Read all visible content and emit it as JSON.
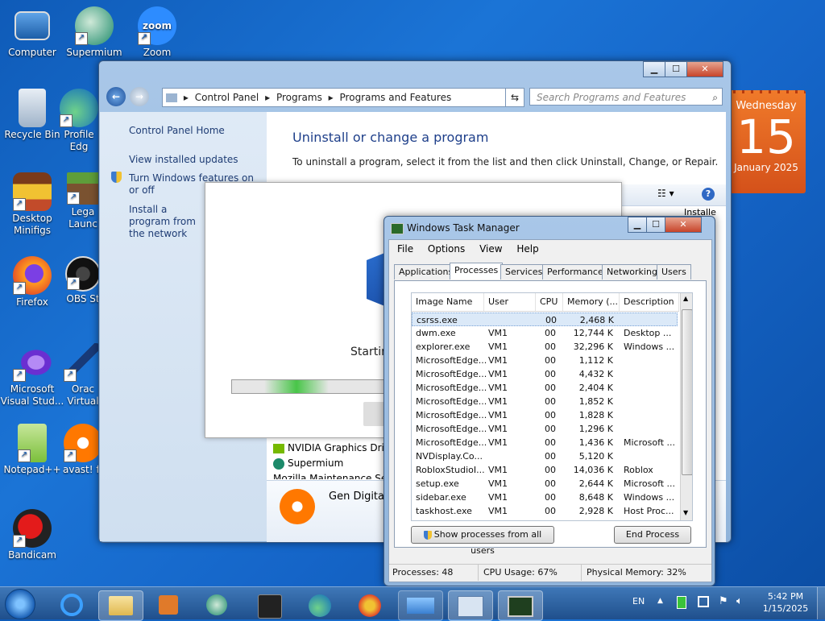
{
  "desktop": {
    "icons": [
      {
        "label": "Computer"
      },
      {
        "label": "Supermium"
      },
      {
        "label": "Zoom"
      },
      {
        "label": "Recycle Bin"
      },
      {
        "label": "Profile\nEdg"
      },
      {
        "label": "Desktop\nMinifigs"
      },
      {
        "label": "Lega\nLaunc"
      },
      {
        "label": "Firefox"
      },
      {
        "label": "OBS St"
      },
      {
        "label": "Microsoft\nVisual Stud..."
      },
      {
        "label": "Orac\nVirtual"
      },
      {
        "label": "Notepad++"
      },
      {
        "label": "avast! fr"
      },
      {
        "label": "Bandicam"
      }
    ],
    "zoom_icon_text": "zoom"
  },
  "calendar": {
    "weekday": "Wednesday",
    "day": "15",
    "month_year": "January 2025",
    "accent": "#e05a17"
  },
  "control_panel": {
    "breadcrumb": [
      "Control Panel",
      "Programs",
      "Programs and Features"
    ],
    "search_placeholder": "Search Programs and Features",
    "left_links": {
      "home": "Control Panel Home",
      "updates": "View installed updates",
      "features": "Turn Windows features on or off",
      "install": "Install a program from the network"
    },
    "heading": "Uninstall or change a program",
    "description": "To uninstall a program, select it from the list and then click Uninstall, Change, or Repair.",
    "programs": [
      "NVIDIA Graphics Driver",
      "Supermium",
      "Mozilla Maintenance Service"
    ],
    "selected_publisher": "Gen Digital",
    "col_header_partial": "Installe"
  },
  "setup_dialog": {
    "status_text": "Starting"
  },
  "task_manager": {
    "title": "Windows Task Manager",
    "menu": [
      "File",
      "Options",
      "View",
      "Help"
    ],
    "tabs": [
      "Applications",
      "Processes",
      "Services",
      "Performance",
      "Networking",
      "Users"
    ],
    "active_tab": "Processes",
    "columns": [
      "Image Name",
      "User Name",
      "CPU",
      "Memory (...",
      "Description"
    ],
    "rows": [
      {
        "name": "csrss.exe",
        "user": "",
        "cpu": "00",
        "mem": "2,468 K",
        "desc": ""
      },
      {
        "name": "dwm.exe",
        "user": "VM1",
        "cpu": "00",
        "mem": "12,744 K",
        "desc": "Desktop ..."
      },
      {
        "name": "explorer.exe",
        "user": "VM1",
        "cpu": "00",
        "mem": "32,296 K",
        "desc": "Windows ..."
      },
      {
        "name": "MicrosoftEdge...",
        "user": "VM1",
        "cpu": "00",
        "mem": "1,112 K",
        "desc": ""
      },
      {
        "name": "MicrosoftEdge...",
        "user": "VM1",
        "cpu": "00",
        "mem": "4,432 K",
        "desc": ""
      },
      {
        "name": "MicrosoftEdge...",
        "user": "VM1",
        "cpu": "00",
        "mem": "2,404 K",
        "desc": ""
      },
      {
        "name": "MicrosoftEdge...",
        "user": "VM1",
        "cpu": "00",
        "mem": "1,852 K",
        "desc": ""
      },
      {
        "name": "MicrosoftEdge...",
        "user": "VM1",
        "cpu": "00",
        "mem": "1,828 K",
        "desc": ""
      },
      {
        "name": "MicrosoftEdge...",
        "user": "VM1",
        "cpu": "00",
        "mem": "1,296 K",
        "desc": ""
      },
      {
        "name": "MicrosoftEdge...",
        "user": "VM1",
        "cpu": "00",
        "mem": "1,436 K",
        "desc": "Microsoft ..."
      },
      {
        "name": "NVDisplay.Co...",
        "user": "",
        "cpu": "00",
        "mem": "5,120 K",
        "desc": ""
      },
      {
        "name": "RobloxStudioI...",
        "user": "VM1",
        "cpu": "00",
        "mem": "14,036 K",
        "desc": "Roblox"
      },
      {
        "name": "setup.exe",
        "user": "VM1",
        "cpu": "00",
        "mem": "2,644 K",
        "desc": "Microsoft ..."
      },
      {
        "name": "sidebar.exe",
        "user": "VM1",
        "cpu": "00",
        "mem": "8,648 K",
        "desc": "Windows ..."
      },
      {
        "name": "taskhost.exe",
        "user": "VM1",
        "cpu": "00",
        "mem": "2,928 K",
        "desc": "Host Proc..."
      }
    ],
    "show_all_button": "Show processes from all users",
    "end_process_button": "End Process",
    "status": {
      "processes": "Processes: 48",
      "cpu": "CPU Usage: 67%",
      "memory": "Physical Memory: 32%"
    }
  },
  "taskbar": {
    "language": "EN",
    "time": "5:42 PM",
    "date": "1/15/2025"
  }
}
